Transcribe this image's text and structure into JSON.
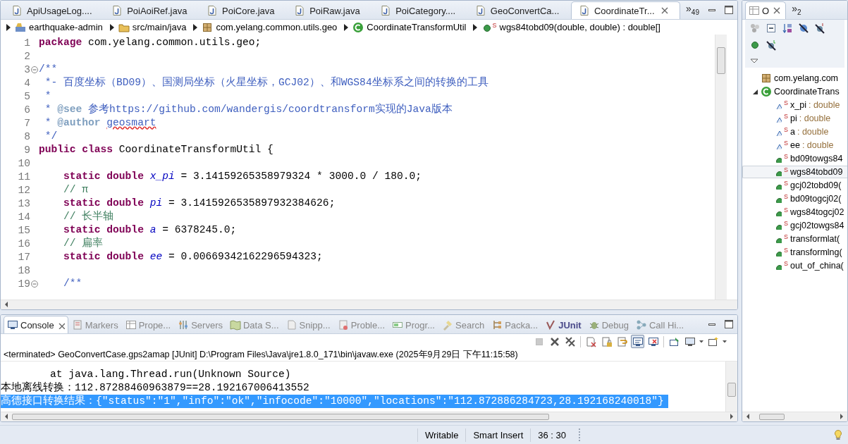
{
  "editor": {
    "tabs": [
      {
        "label": "ApiUsageLog....",
        "selected": false
      },
      {
        "label": "PoiAoiRef.java",
        "selected": false
      },
      {
        "label": "PoiCore.java",
        "selected": false
      },
      {
        "label": "PoiRaw.java",
        "selected": false
      },
      {
        "label": "PoiCategory....",
        "selected": false
      },
      {
        "label": "GeoConvertCa...",
        "selected": false
      },
      {
        "label": "CoordinateTr...",
        "selected": true
      }
    ],
    "overflow": {
      "chevron": "»",
      "count": "49"
    },
    "breadcrumb": [
      {
        "kind": "project",
        "label": "earthquake-admin"
      },
      {
        "kind": "source-folder",
        "label": "src/main/java"
      },
      {
        "kind": "package",
        "label": "com.yelang.common.utils.geo"
      },
      {
        "kind": "class",
        "label": "CoordinateTransformUtil"
      },
      {
        "kind": "method",
        "badge": "S",
        "label": "wgs84tobd09(double, double) : double[]"
      }
    ],
    "lines": [
      {
        "num": "1",
        "fold": false,
        "tokens": [
          {
            "kind": "kw",
            "text": "package "
          },
          {
            "kind": "plain",
            "text": "com.yelang.common.utils.geo;"
          }
        ]
      },
      {
        "num": "2",
        "fold": false
      },
      {
        "num": "3",
        "fold": true,
        "tokens": [
          {
            "kind": "doc",
            "text": "/**"
          }
        ]
      },
      {
        "num": "4",
        "fold": false,
        "tokens": [
          {
            "kind": "doc",
            "text": " *- 百度坐标（BD09）、国测局坐标（火星坐标，GCJ02）、和WGS84坐标系之间的转换的工具"
          }
        ]
      },
      {
        "num": "5",
        "fold": false,
        "tokens": [
          {
            "kind": "doc",
            "text": " *"
          }
        ]
      },
      {
        "num": "6",
        "fold": false,
        "tokens": [
          {
            "kind": "doc",
            "text": " * "
          },
          {
            "kind": "tag",
            "text": "@see "
          },
          {
            "kind": "doc",
            "text": "参考https://github.com/wandergis/coordtransform实现的Java版本"
          }
        ]
      },
      {
        "num": "7",
        "fold": false,
        "tokens": [
          {
            "kind": "doc",
            "text": " * "
          },
          {
            "kind": "tag",
            "text": "@author "
          },
          {
            "kind": "misspelled",
            "text": "geosmart"
          }
        ]
      },
      {
        "num": "8",
        "fold": false,
        "tokens": [
          {
            "kind": "doc",
            "text": " */"
          }
        ]
      },
      {
        "num": "9",
        "fold": false,
        "tokens": [
          {
            "kind": "kw",
            "text": "public "
          },
          {
            "kind": "kw",
            "text": "class "
          },
          {
            "kind": "plain",
            "text": "CoordinateTransformUtil {"
          }
        ]
      },
      {
        "num": "10",
        "fold": false
      },
      {
        "num": "11",
        "fold": false,
        "tokens": [
          {
            "kind": "kw",
            "text": "    static "
          },
          {
            "kind": "kw",
            "text": "double "
          },
          {
            "kind": "field",
            "text": "x_pi"
          },
          {
            "kind": "plain",
            "text": " = 3.14159265358979324 * 3000.0 / 180.0;"
          }
        ]
      },
      {
        "num": "12",
        "fold": false,
        "tokens": [
          {
            "kind": "comment",
            "text": "    // π"
          }
        ]
      },
      {
        "num": "13",
        "fold": false,
        "tokens": [
          {
            "kind": "kw",
            "text": "    static "
          },
          {
            "kind": "kw",
            "text": "double "
          },
          {
            "kind": "field",
            "text": "pi"
          },
          {
            "kind": "plain",
            "text": " = 3.1415926535897932384626;"
          }
        ]
      },
      {
        "num": "14",
        "fold": false,
        "tokens": [
          {
            "kind": "comment",
            "text": "    // 长半轴"
          }
        ]
      },
      {
        "num": "15",
        "fold": false,
        "tokens": [
          {
            "kind": "kw",
            "text": "    static "
          },
          {
            "kind": "kw",
            "text": "double "
          },
          {
            "kind": "field",
            "text": "a"
          },
          {
            "kind": "plain",
            "text": " = 6378245.0;"
          }
        ]
      },
      {
        "num": "16",
        "fold": false,
        "tokens": [
          {
            "kind": "comment",
            "text": "    // 扁率"
          }
        ]
      },
      {
        "num": "17",
        "fold": false,
        "tokens": [
          {
            "kind": "kw",
            "text": "    static "
          },
          {
            "kind": "kw",
            "text": "double "
          },
          {
            "kind": "field",
            "text": "ee"
          },
          {
            "kind": "plain",
            "text": " = 0.00669342162296594323;"
          }
        ]
      },
      {
        "num": "18",
        "fold": false
      },
      {
        "num": "19",
        "fold": true,
        "tokens": [
          {
            "kind": "doc",
            "text": "    /**"
          }
        ]
      }
    ]
  },
  "outline": {
    "tab": {
      "label": "O",
      "selected": true
    },
    "overflow": {
      "chevron": "»",
      "count": "2"
    },
    "tree": [
      {
        "kind": "package",
        "label": "com.yelang.com",
        "selected": false
      },
      {
        "kind": "class",
        "label": "CoordinateTrans",
        "expanded": true,
        "selected": false,
        "children": [
          {
            "kind": "field",
            "badge": "S",
            "label": "x_pi",
            "type": " : double",
            "selected": false
          },
          {
            "kind": "field",
            "badge": "S",
            "label": "pi",
            "type": " : double",
            "selected": false
          },
          {
            "kind": "field",
            "badge": "S",
            "label": "a",
            "type": " : double",
            "selected": false
          },
          {
            "kind": "field",
            "badge": "S",
            "label": "ee",
            "type": " : double",
            "selected": false
          },
          {
            "kind": "method",
            "badge": "S",
            "label": "bd09towgs84",
            "selected": false
          },
          {
            "kind": "method",
            "badge": "S",
            "label": "wgs84tobd09",
            "selected": true
          },
          {
            "kind": "method",
            "badge": "S",
            "label": "gcj02tobd09(",
            "selected": false
          },
          {
            "kind": "method",
            "badge": "S",
            "label": "bd09togcj02(",
            "selected": false
          },
          {
            "kind": "method",
            "badge": "S",
            "label": "wgs84togcj02",
            "selected": false
          },
          {
            "kind": "method",
            "badge": "S",
            "label": "gcj02towgs84",
            "selected": false
          },
          {
            "kind": "method",
            "badge": "S",
            "label": "transformlat(",
            "selected": false
          },
          {
            "kind": "method",
            "badge": "S",
            "label": "transformlng(",
            "selected": false
          },
          {
            "kind": "method",
            "badge": "S",
            "label": "out_of_china(",
            "selected": false
          }
        ]
      }
    ]
  },
  "console": {
    "tabs": [
      {
        "kind": "console",
        "label": "Console",
        "selected": true,
        "changed": false
      },
      {
        "kind": "markers",
        "label": "Markers",
        "selected": false,
        "changed": false
      },
      {
        "kind": "properties",
        "label": "Prope...",
        "selected": false,
        "changed": false
      },
      {
        "kind": "servers",
        "label": "Servers",
        "selected": false,
        "changed": false
      },
      {
        "kind": "data",
        "label": "Data S...",
        "selected": false,
        "changed": false
      },
      {
        "kind": "snippets",
        "label": "Snipp...",
        "selected": false,
        "changed": false
      },
      {
        "kind": "problems",
        "label": "Proble...",
        "selected": false,
        "changed": false
      },
      {
        "kind": "progress",
        "label": "Progr...",
        "selected": false,
        "changed": false
      },
      {
        "kind": "search",
        "label": "Search",
        "selected": false,
        "changed": false
      },
      {
        "kind": "packages",
        "label": "Packa...",
        "selected": false,
        "changed": false
      },
      {
        "kind": "junit",
        "label": "JUnit",
        "selected": false,
        "changed": true
      },
      {
        "kind": "debug",
        "label": "Debug",
        "selected": false,
        "changed": false
      },
      {
        "kind": "callh",
        "label": "Call Hi...",
        "selected": false,
        "changed": false
      }
    ],
    "toolbar": [
      {
        "kind": "stop",
        "pressed": false,
        "disabled": true
      },
      {
        "kind": "remove",
        "pressed": false,
        "disabled": false
      },
      {
        "kind": "removeall",
        "pressed": false,
        "disabled": false
      },
      {
        "kind": "clear",
        "pressed": false,
        "disabled": false
      },
      {
        "kind": "lock",
        "pressed": false,
        "disabled": false
      },
      {
        "kind": "wrap",
        "pressed": false,
        "disabled": false
      },
      {
        "kind": "showout",
        "pressed": true,
        "disabled": false
      },
      {
        "kind": "showerr",
        "pressed": false,
        "disabled": false
      },
      {
        "kind": "pin",
        "pressed": false,
        "disabled": false
      },
      {
        "kind": "display",
        "pressed": false,
        "disabled": false
      },
      {
        "kind": "newconsole",
        "pressed": false,
        "disabled": false
      }
    ],
    "header": "<terminated> GeoConvertCase.gps2amap [JUnit] D:\\Program Files\\Java\\jre1.8.0_171\\bin\\javaw.exe (2025年9月29日 下午11:15:58)",
    "lines": [
      {
        "text": "\tat java.lang.Thread.run(Unknown Source)",
        "selected": false
      },
      {
        "text": "本地离线转换：112.87288460963879==28.192167006413552",
        "selected": false
      },
      {
        "text": "高德接口转换结果：{\"status\":\"1\",\"info\":\"ok\",\"infocode\":\"10000\",\"locations\":\"112.872886284723,28.192168240018\"}",
        "selected": true
      }
    ]
  },
  "status_bar": [
    "Writable",
    "Smart Insert",
    "36 : 30"
  ]
}
